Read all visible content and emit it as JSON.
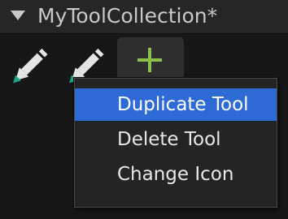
{
  "header": {
    "title": "MyToolCollection*",
    "collapse_icon": "triangle-down-icon"
  },
  "toolbar": {
    "tools": [
      {
        "icon": "pencil-icon"
      },
      {
        "icon": "pencil-icon"
      }
    ],
    "add_icon": "plus-icon"
  },
  "context_menu": {
    "items": [
      {
        "label": "Duplicate Tool",
        "highlighted": true
      },
      {
        "label": "Delete Tool",
        "highlighted": false
      },
      {
        "label": "Change Icon",
        "highlighted": false
      }
    ]
  },
  "colors": {
    "background": "#171717",
    "header_background": "#262626",
    "menu_background": "#242424",
    "menu_highlight": "#2e6ad6",
    "accent_green": "#8cc04a",
    "pencil_teal": "#1fa88a"
  }
}
